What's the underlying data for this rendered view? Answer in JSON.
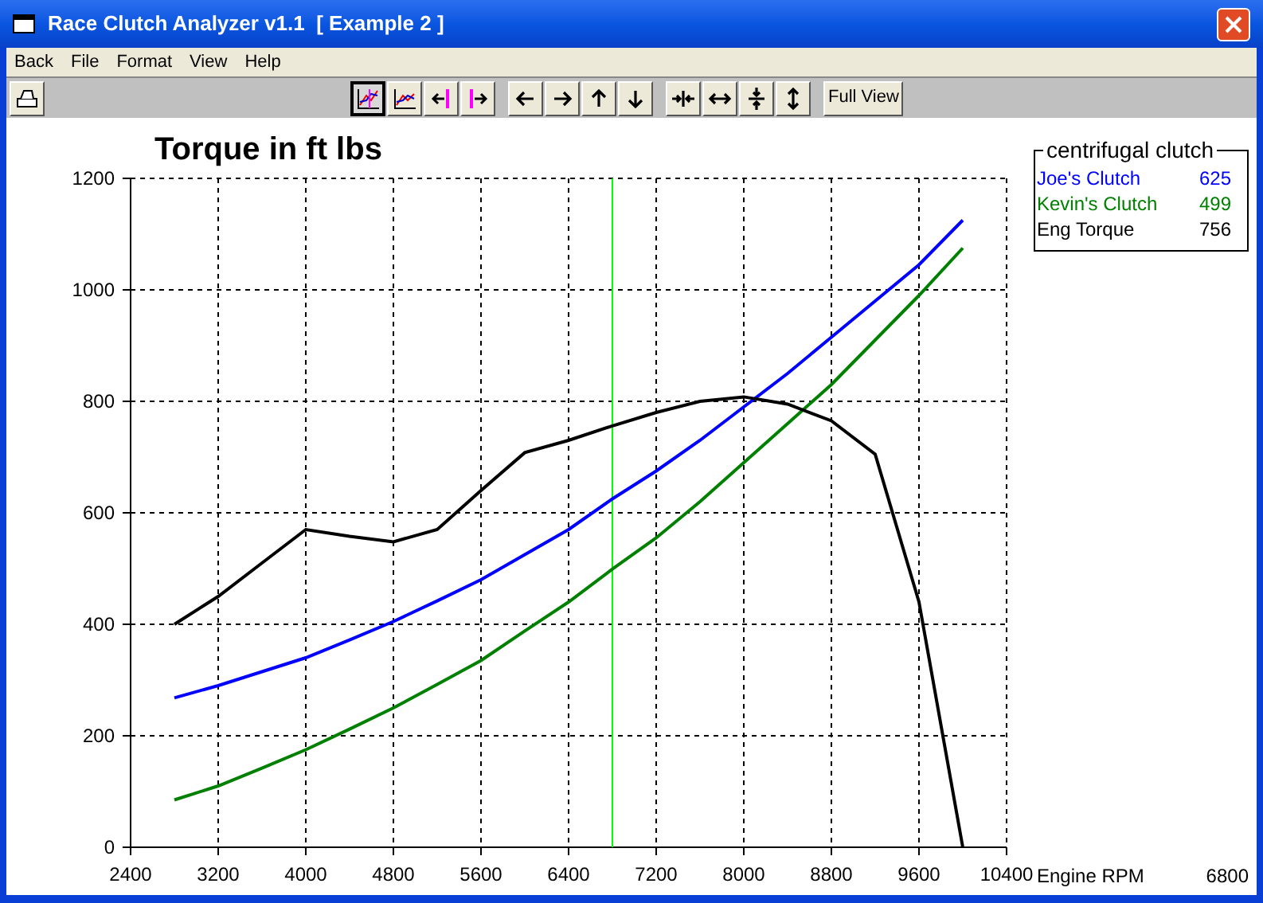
{
  "window": {
    "title": "Race Clutch Analyzer v1.1  [ Example 2 ]"
  },
  "menu": [
    {
      "label": "Back"
    },
    {
      "label": "File"
    },
    {
      "label": "Format"
    },
    {
      "label": "View"
    },
    {
      "label": "Help"
    }
  ],
  "toolbar": [
    {
      "kind": "print",
      "selected": false
    },
    {
      "kind": "chart-a",
      "selected": true
    },
    {
      "kind": "chart-b",
      "selected": false
    },
    {
      "kind": "bar-left",
      "selected": false
    },
    {
      "kind": "bar-right",
      "selected": false
    },
    {
      "kind": "left",
      "selected": false
    },
    {
      "kind": "right",
      "selected": false
    },
    {
      "kind": "up",
      "selected": false
    },
    {
      "kind": "down",
      "selected": false
    },
    {
      "kind": "squeeze-h",
      "selected": false
    },
    {
      "kind": "stretch-h",
      "selected": false
    },
    {
      "kind": "squeeze-v",
      "selected": false
    },
    {
      "kind": "stretch-v",
      "selected": false
    },
    {
      "kind": "text",
      "label": "Full View",
      "selected": false
    }
  ],
  "chart": {
    "chart_data": {
      "type": "line",
      "title": "Torque in ft lbs",
      "x": [
        2800,
        3200,
        3600,
        4000,
        4400,
        4800,
        5200,
        5600,
        6000,
        6400,
        6800,
        7200,
        7600,
        8000,
        8400,
        8800,
        9200,
        9600,
        10000
      ],
      "series": [
        {
          "name": "Joe's Clutch",
          "color": "#0000ff",
          "values": [
            268,
            290,
            315,
            340,
            372,
            405,
            442,
            480,
            525,
            570,
            625,
            675,
            730,
            790,
            850,
            915,
            980,
            1045,
            1125
          ]
        },
        {
          "name": "Kevin's Clutch",
          "color": "#008000",
          "values": [
            85,
            110,
            142,
            175,
            212,
            250,
            292,
            335,
            388,
            440,
            499,
            555,
            620,
            690,
            760,
            830,
            910,
            990,
            1075
          ]
        },
        {
          "name": "Eng Torque",
          "color": "#000000",
          "values": [
            400,
            450,
            510,
            570,
            558,
            548,
            570,
            640,
            708,
            730,
            756,
            780,
            800,
            808,
            795,
            765,
            705,
            440,
            0
          ]
        }
      ],
      "xlim": [
        2400,
        10400
      ],
      "ylim": [
        0,
        1200
      ],
      "xticks": [
        2400,
        3200,
        4000,
        4800,
        5600,
        6400,
        7200,
        8000,
        8800,
        9600,
        10400
      ],
      "yticks": [
        0,
        200,
        400,
        600,
        800,
        1000,
        1200
      ],
      "grid": true,
      "ref_lines": [
        {
          "axis": "x",
          "value": 6800,
          "color": "#00ff00"
        }
      ]
    }
  },
  "legend": {
    "title": "centrifugal clutch",
    "items": [
      {
        "value": "625"
      },
      {
        "value": "499"
      },
      {
        "value": "756"
      }
    ]
  },
  "readout": {
    "label": "Engine RPM",
    "value": "6800"
  }
}
